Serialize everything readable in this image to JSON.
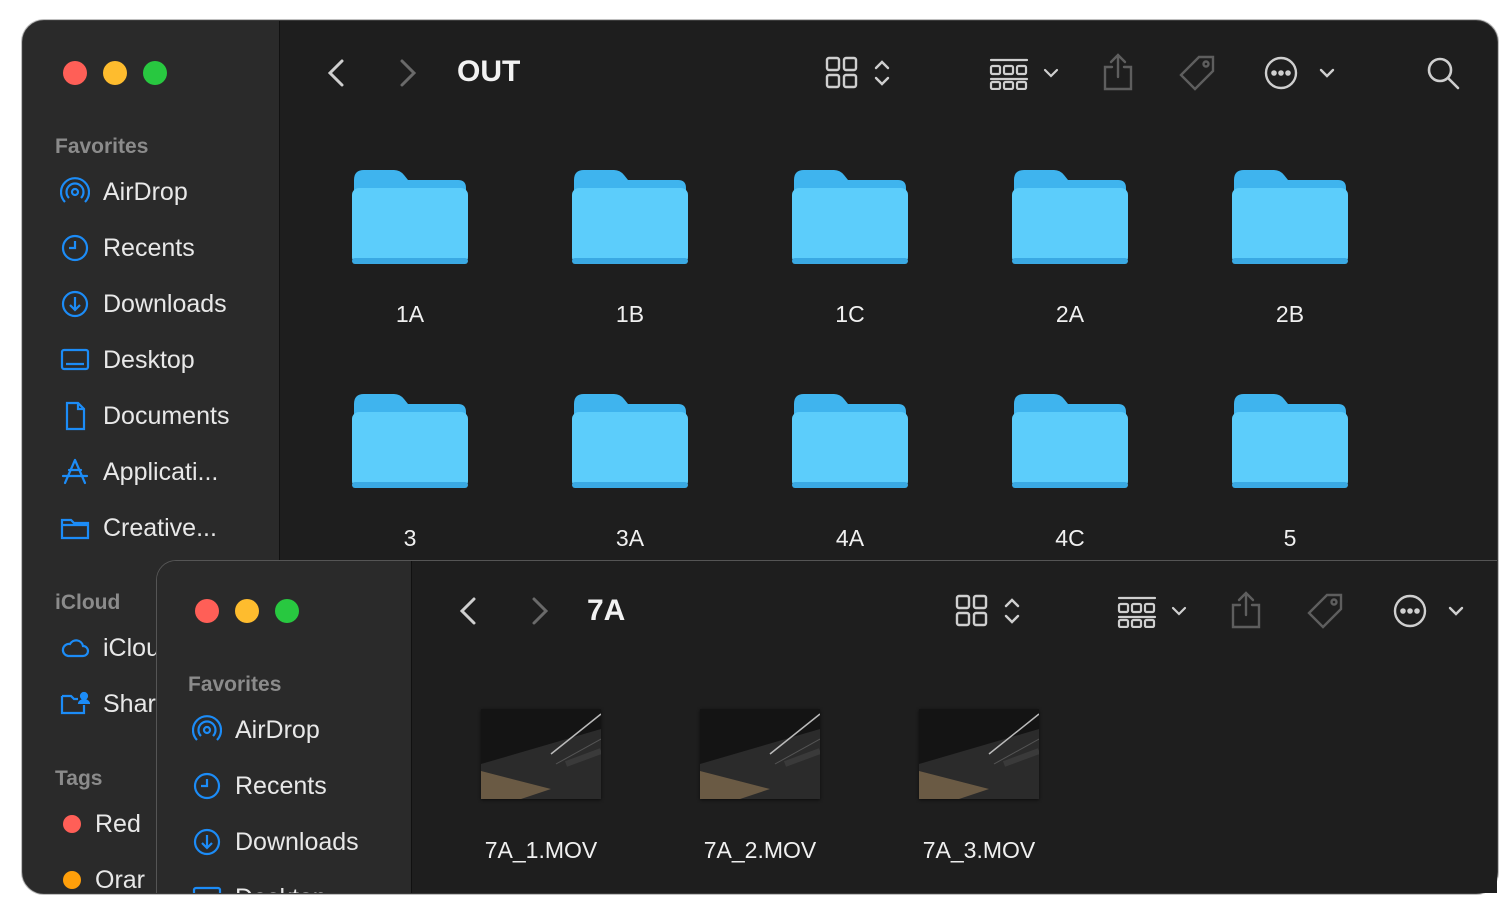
{
  "win1": {
    "title": "OUT",
    "favorites_label": "Favorites",
    "favorites": [
      "AirDrop",
      "Recents",
      "Downloads",
      "Desktop",
      "Documents",
      "Applicati...",
      "Creative..."
    ],
    "icloud_label": "iCloud",
    "icloud": [
      "iClou",
      "Shar"
    ],
    "tags_label": "Tags",
    "tags": [
      {
        "label": "Red",
        "color": "#ff5f57"
      },
      {
        "label": "Orar",
        "color": "#ff9f0a"
      }
    ],
    "folders": [
      "1A",
      "1B",
      "1C",
      "2A",
      "2B",
      "3",
      "3A",
      "4A",
      "4C",
      "5"
    ]
  },
  "win2": {
    "title": "7A",
    "favorites_label": "Favorites",
    "favorites": [
      "AirDrop",
      "Recents",
      "Downloads",
      "Desktop"
    ],
    "files": [
      "7A_1.MOV",
      "7A_2.MOV",
      "7A_3.MOV"
    ]
  },
  "colors": {
    "accent": "#1c8cf7",
    "folder": "#5ccdfb",
    "window_bg": "#1e1e1e",
    "sidebar_bg": "#2a2a2a"
  },
  "icons": {
    "toolbar": [
      "back-chevron-icon",
      "forward-chevron-icon",
      "icon-view-icon",
      "group-view-icon",
      "share-icon",
      "tag-icon",
      "more-icon",
      "search-icon"
    ]
  }
}
